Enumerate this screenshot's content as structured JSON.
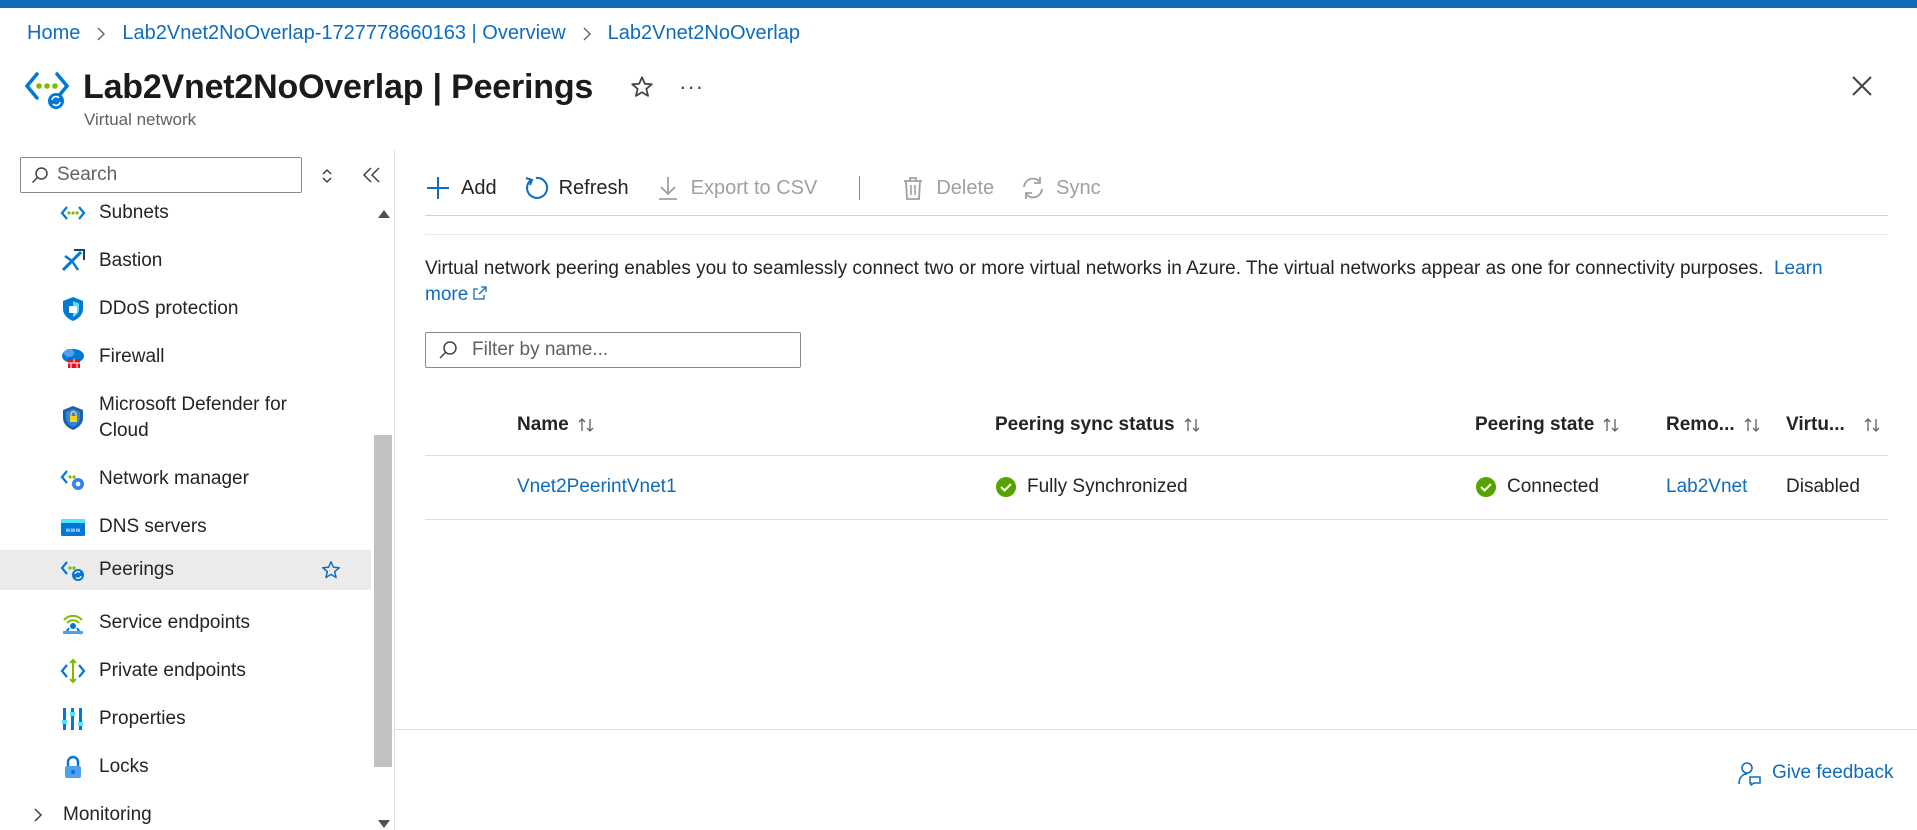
{
  "breadcrumb": [
    {
      "label": "Home"
    },
    {
      "label": "Lab2Vnet2NoOverlap-1727778660163 | Overview"
    },
    {
      "label": "Lab2Vnet2NoOverlap"
    }
  ],
  "header": {
    "title": "Lab2Vnet2NoOverlap | Peerings",
    "subtitle": "Virtual network",
    "more_label": "···"
  },
  "sidebar": {
    "search_placeholder": "Search",
    "items": [
      {
        "label": "Subnets",
        "icon": "subnets-icon"
      },
      {
        "label": "Bastion",
        "icon": "bastion-icon"
      },
      {
        "label": "DDoS protection",
        "icon": "ddos-shield-icon"
      },
      {
        "label": "Firewall",
        "icon": "firewall-icon"
      },
      {
        "label": "Microsoft Defender for",
        "label2": "Cloud",
        "icon": "defender-shield-icon"
      },
      {
        "label": "Network manager",
        "icon": "network-manager-icon"
      },
      {
        "label": "DNS servers",
        "icon": "dns-servers-icon"
      },
      {
        "label": "Peerings",
        "icon": "peerings-icon",
        "active": true
      },
      {
        "label": "Service endpoints",
        "icon": "service-endpoints-icon"
      },
      {
        "label": "Private endpoints",
        "icon": "private-endpoints-icon"
      },
      {
        "label": "Properties",
        "icon": "properties-icon"
      },
      {
        "label": "Locks",
        "icon": "lock-icon"
      },
      {
        "label": "Monitoring",
        "icon": "chevron-right-icon"
      }
    ]
  },
  "toolbar": {
    "add": "Add",
    "refresh": "Refresh",
    "export": "Export to CSV",
    "delete": "Delete",
    "sync": "Sync"
  },
  "description": {
    "text": "Virtual network peering enables you to seamlessly connect two or more virtual networks in Azure. The virtual networks appear as one for connectivity purposes.",
    "link": "Learn more"
  },
  "filter": {
    "placeholder": "Filter by name..."
  },
  "table": {
    "columns": [
      "Name",
      "Peering sync status",
      "Peering state",
      "Remo...",
      "Virtu..."
    ],
    "rows": [
      {
        "name": "Vnet2PeerintVnet1",
        "sync_status": "Fully Synchronized",
        "state": "Connected",
        "remote": "Lab2Vnet",
        "virtual": "Disabled"
      }
    ]
  },
  "footer": {
    "feedback": "Give feedback"
  },
  "colors": {
    "accent": "#0f6cbd",
    "success": "#57a300"
  }
}
